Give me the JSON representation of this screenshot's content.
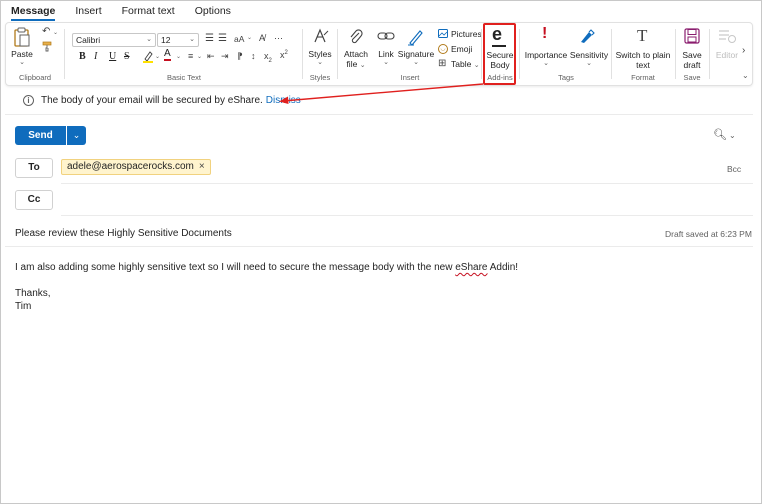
{
  "tabs": [
    "Message",
    "Insert",
    "Format text",
    "Options"
  ],
  "ribbon": {
    "clipboard": {
      "paste": "Paste",
      "group": "Clipboard"
    },
    "basic_text": {
      "font": "Calibri",
      "size": "12",
      "group": "Basic Text"
    },
    "styles": {
      "label": "Styles",
      "group": "Styles"
    },
    "insert": {
      "attach_line1": "Attach",
      "attach_line2": "file",
      "link": "Link",
      "signature": "Signature",
      "pictures": "Pictures",
      "emoji": "Emoji",
      "table": "Table",
      "group": "Insert"
    },
    "addins": {
      "secure_line1": "Secure",
      "secure_line2": "Body",
      "group": "Add-ins"
    },
    "tags": {
      "importance": "Importance",
      "sensitivity": "Sensitivity",
      "group": "Tags"
    },
    "format": {
      "line1": "Switch to plain",
      "line2": "text",
      "group": "Format"
    },
    "save": {
      "line1": "Save",
      "line2": "draft",
      "group": "Save"
    },
    "editor": "Editor"
  },
  "infobar": {
    "message": "The body of your email will be secured by eShare.",
    "dismiss": "Dismiss"
  },
  "compose": {
    "send": "Send",
    "to_label": "To",
    "cc_label": "Cc",
    "bcc_label": "Bcc",
    "recipient": "adele@aerospacerocks.com",
    "subject": "Please review these Highly Sensitive Documents",
    "draft_saved": "Draft saved at 6:23 PM",
    "body_before": "I am also adding some highly sensitive text so I will need to secure the message body with the new ",
    "body_misspelled": "eShare",
    "body_after": " Addin!",
    "closing": "Thanks,",
    "signature": "Tim"
  },
  "colors": {
    "accent": "#0f6cbd",
    "highlight_box": "#e0201e",
    "recipient_bg": "#fff4ce"
  }
}
